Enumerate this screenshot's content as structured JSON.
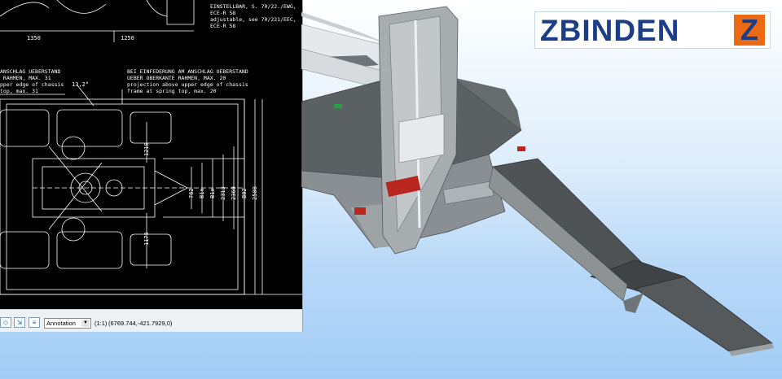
{
  "drawing": {
    "note_top": "EINSTELLBAR, S. 70/22./EWG,\nECE-R 58\nadjustable, see 70/221/EEC,\nECE-R 58",
    "note_left": "ANSCHLAG UEBERSTAND\n RAHMEN, MAX. 31\npper edge of chassis\ntop, max. 31",
    "note_right": "BEI EINFEDERUNG AM ANSCHLAG UEBERSTAND\nUEBER OBERKANTE RAHMEN, MAX. 20\nprojection above upper edge of chassis\nframe at spring top, max. 20",
    "dim_1350": "1350",
    "dim_1250": "1250",
    "dim_13_2": "13,2°",
    "dim_1218": "1218",
    "dim_1175": "1175",
    "dim_762": "762",
    "dim_b1x_1": "B1x",
    "dim_b1x_2": "B1x",
    "dim_2313": "2313",
    "dim_2360": "2360",
    "dim_b02": "B02",
    "dim_2500": "2500"
  },
  "status_bar": {
    "annotation_value": "Annotation",
    "scale": "(1:1)",
    "coordinates": "(6769.744,-421.7929,0)"
  },
  "logo": {
    "name": "ZBINDEN",
    "mark": "Z",
    "colors": {
      "text": "#1b3e86",
      "mark": "#eb6a13"
    }
  },
  "icons": [
    "annotation-visibility-icon",
    "annotation-scale-icon",
    "add-scale-icon",
    "dropdown-arrow-icon"
  ]
}
